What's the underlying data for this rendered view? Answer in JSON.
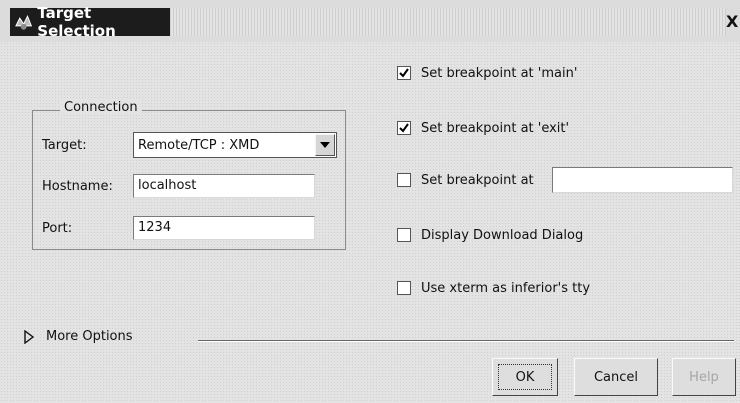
{
  "window": {
    "title": "Target Selection",
    "close_glyph": "X"
  },
  "connection": {
    "legend": "Connection",
    "target_label": "Target:",
    "target_value": "Remote/TCP : XMD",
    "hostname_label": "Hostname:",
    "hostname_value": "localhost",
    "port_label": "Port:",
    "port_value": "1234"
  },
  "options": [
    {
      "label": "Set breakpoint at 'main'",
      "checked": true
    },
    {
      "label": "Set breakpoint at 'exit'",
      "checked": true
    },
    {
      "label": "Set breakpoint at",
      "checked": false,
      "input_value": ""
    },
    {
      "label": "Display Download Dialog",
      "checked": false
    },
    {
      "label": "Use xterm as inferior's tty",
      "checked": false
    }
  ],
  "more_options_label": "More Options",
  "buttons": {
    "ok": "OK",
    "cancel": "Cancel",
    "help": "Help"
  }
}
